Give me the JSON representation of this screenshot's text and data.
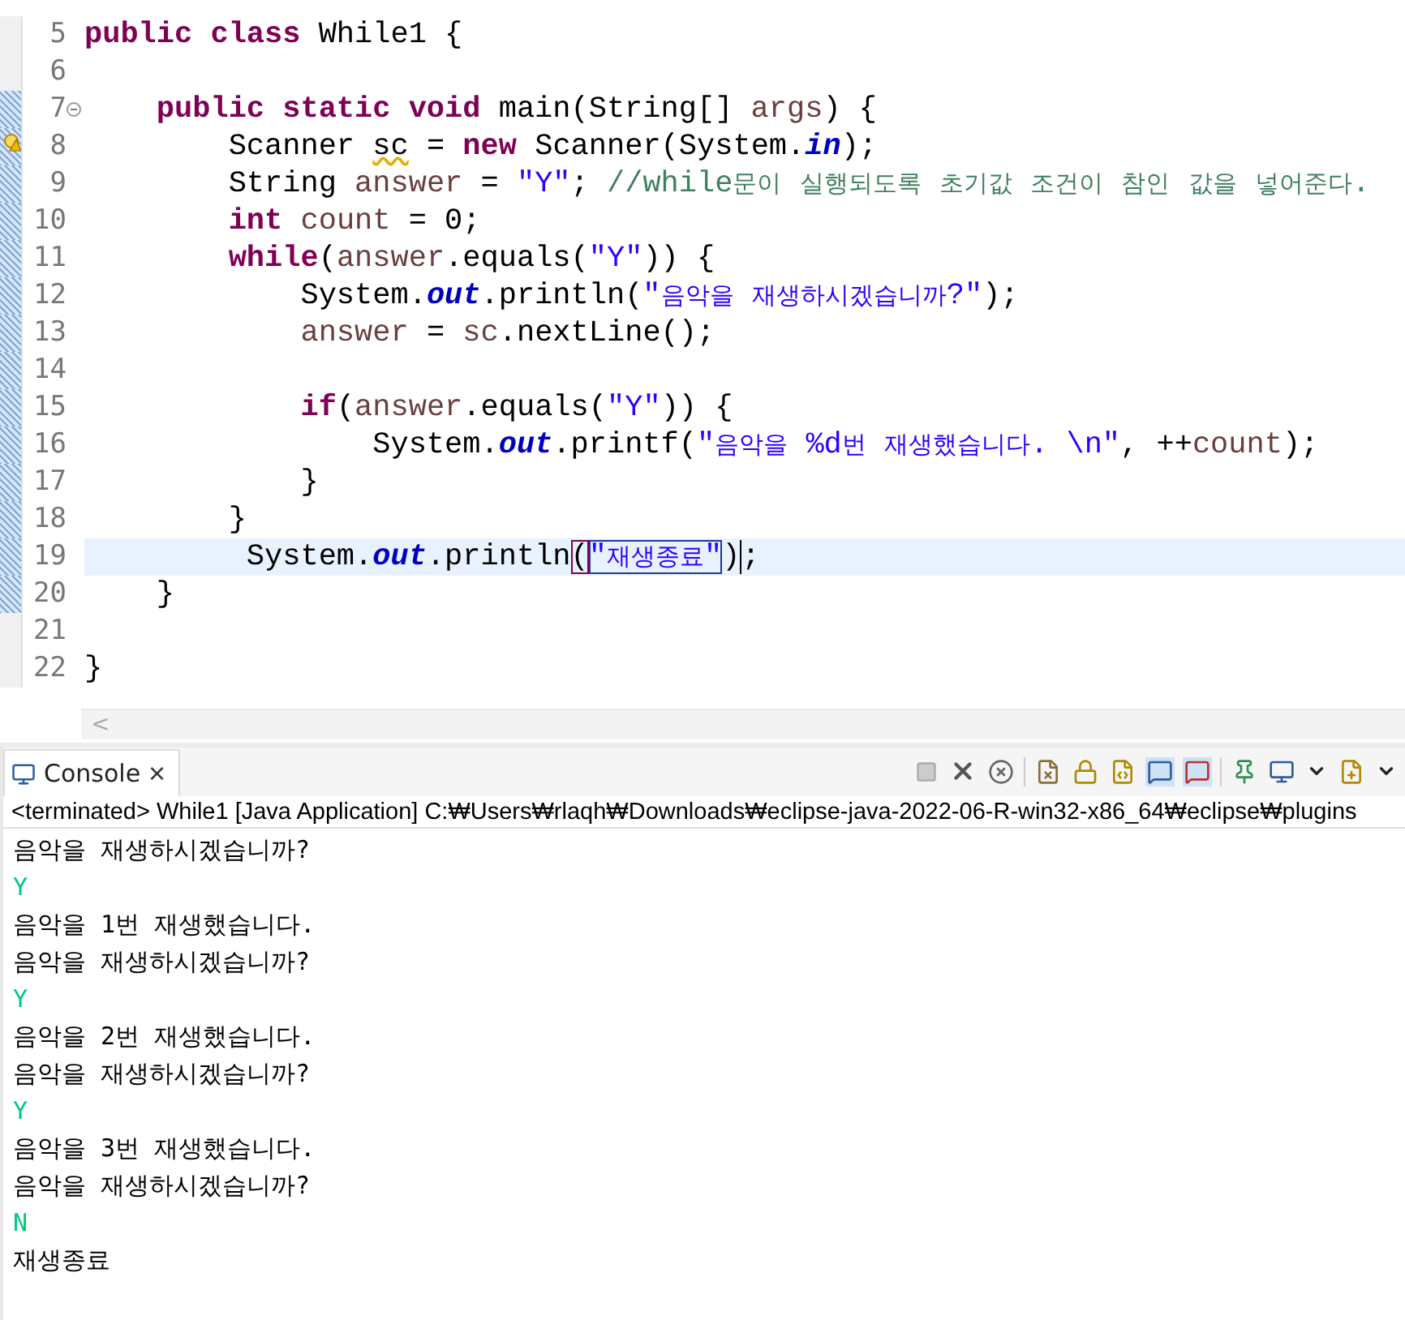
{
  "editor": {
    "lines": [
      {
        "number": "5",
        "current": false,
        "fold": false,
        "warning": false,
        "tokens": [
          {
            "text": "public class ",
            "kind": "keyword"
          },
          {
            "text": "While1 {",
            "kind": "plain"
          }
        ]
      },
      {
        "number": "6",
        "current": false,
        "fold": false,
        "warning": false
      },
      {
        "number": "7",
        "current": false,
        "fold": true,
        "warning": false,
        "tokens": [
          {
            "text": "    public static void ",
            "kind": "keyword"
          },
          {
            "text": "main(String[] ",
            "kind": "plain"
          },
          {
            "text": "args",
            "kind": "var"
          },
          {
            "text": ") {",
            "kind": "plain"
          }
        ]
      },
      {
        "number": "8",
        "current": false,
        "fold": false,
        "warning": true,
        "tokens": [
          {
            "text": "        Scanner ",
            "kind": "plain"
          },
          {
            "text": "sc",
            "kind": "squiggle"
          },
          {
            "text": " = ",
            "kind": "plain"
          },
          {
            "text": "new ",
            "kind": "keyword"
          },
          {
            "text": "Scanner(System.",
            "kind": "plain"
          },
          {
            "text": "in",
            "kind": "field"
          },
          {
            "text": ");",
            "kind": "plain"
          }
        ]
      },
      {
        "number": "9",
        "current": false,
        "fold": false,
        "warning": false,
        "tokens": [
          {
            "text": "        String ",
            "kind": "plain"
          },
          {
            "text": "answer",
            "kind": "var"
          },
          {
            "text": " = ",
            "kind": "plain"
          },
          {
            "text": "\"Y\"",
            "kind": "string"
          },
          {
            "text": "; ",
            "kind": "plain"
          },
          {
            "text": "//while문이 실행되도록 초기값 조건이 참인 값을 넣어준다.",
            "kind": "comment"
          }
        ]
      },
      {
        "number": "10",
        "current": false,
        "fold": false,
        "warning": false,
        "tokens": [
          {
            "text": "        int ",
            "kind": "keyword"
          },
          {
            "text": "count",
            "kind": "var"
          },
          {
            "text": " = 0;",
            "kind": "plain"
          }
        ]
      },
      {
        "number": "11",
        "current": false,
        "fold": false,
        "warning": false,
        "tokens": [
          {
            "text": "        while",
            "kind": "keyword"
          },
          {
            "text": "(",
            "kind": "plain"
          },
          {
            "text": "answer",
            "kind": "var"
          },
          {
            "text": ".equals(",
            "kind": "plain"
          },
          {
            "text": "\"Y\"",
            "kind": "string"
          },
          {
            "text": ")) {",
            "kind": "plain"
          }
        ]
      },
      {
        "number": "12",
        "current": false,
        "fold": false,
        "warning": false,
        "tokens": [
          {
            "text": "            System.",
            "kind": "plain"
          },
          {
            "text": "out",
            "kind": "field"
          },
          {
            "text": ".println(",
            "kind": "plain"
          },
          {
            "text": "\"음악을 재생하시겠습니까?\"",
            "kind": "string"
          },
          {
            "text": ");",
            "kind": "plain"
          }
        ]
      },
      {
        "number": "13",
        "current": false,
        "fold": false,
        "warning": false,
        "tokens": [
          {
            "text": "            answer",
            "kind": "var"
          },
          {
            "text": " = ",
            "kind": "plain"
          },
          {
            "text": "sc",
            "kind": "var"
          },
          {
            "text": ".nextLine();",
            "kind": "plain"
          }
        ]
      },
      {
        "number": "14",
        "current": false,
        "fold": false,
        "warning": false
      },
      {
        "number": "15",
        "current": false,
        "fold": false,
        "warning": false,
        "tokens": [
          {
            "text": "            if",
            "kind": "keyword"
          },
          {
            "text": "(",
            "kind": "plain"
          },
          {
            "text": "answer",
            "kind": "var"
          },
          {
            "text": ".equals(",
            "kind": "plain"
          },
          {
            "text": "\"Y\"",
            "kind": "string"
          },
          {
            "text": ")) {",
            "kind": "plain"
          }
        ]
      },
      {
        "number": "16",
        "current": false,
        "fold": false,
        "warning": false,
        "tokens": [
          {
            "text": "                System.",
            "kind": "plain"
          },
          {
            "text": "out",
            "kind": "field"
          },
          {
            "text": ".printf(",
            "kind": "plain"
          },
          {
            "text": "\"음악을 %d번 재생했습니다. \\n\"",
            "kind": "string"
          },
          {
            "text": ", ++",
            "kind": "plain"
          },
          {
            "text": "count",
            "kind": "var"
          },
          {
            "text": ");",
            "kind": "plain"
          }
        ]
      },
      {
        "number": "17",
        "current": false,
        "fold": false,
        "warning": false,
        "tokens": [
          {
            "text": "            }",
            "kind": "plain"
          }
        ]
      },
      {
        "number": "18",
        "current": false,
        "fold": false,
        "warning": false,
        "tokens": [
          {
            "text": "        }",
            "kind": "plain"
          }
        ]
      },
      {
        "number": "19",
        "current": true,
        "fold": false,
        "warning": false,
        "tokens": [
          {
            "text": "         System.",
            "kind": "plain"
          },
          {
            "text": "out",
            "kind": "field"
          },
          {
            "text": ".println",
            "kind": "plain"
          },
          {
            "text": "(",
            "kind": "match"
          },
          {
            "text": "\"재생종료\"",
            "kind": "matchstring"
          },
          {
            "text": ")",
            "kind": "caret"
          },
          {
            "text": ";",
            "kind": "plain"
          }
        ]
      },
      {
        "number": "20",
        "current": false,
        "fold": false,
        "warning": false,
        "tokens": [
          {
            "text": "    }",
            "kind": "plain"
          }
        ]
      },
      {
        "number": "21",
        "current": false,
        "fold": false,
        "warning": false
      },
      {
        "number": "22",
        "current": false,
        "fold": false,
        "warning": false,
        "tokens": [
          {
            "text": "}",
            "kind": "plain"
          }
        ]
      }
    ],
    "scroll_arrow": "<"
  },
  "console": {
    "tab": {
      "label": "Console",
      "close": "×"
    },
    "status": "<terminated> While1 [Java Application] C:₩Users₩rlaqh₩Downloads₩eclipse-java-2022-06-R-win32-x86_64₩eclipse₩plugins",
    "output": [
      {
        "text": "음악을 재생하시겠습니까?",
        "kind": "out"
      },
      {
        "text": "Y",
        "kind": "in"
      },
      {
        "text": "음악을 1번 재생했습니다.",
        "kind": "out"
      },
      {
        "text": "음악을 재생하시겠습니까?",
        "kind": "out"
      },
      {
        "text": "Y",
        "kind": "in"
      },
      {
        "text": "음악을 2번 재생했습니다.",
        "kind": "out"
      },
      {
        "text": "음악을 재생하시겠습니까?",
        "kind": "out"
      },
      {
        "text": "Y",
        "kind": "in"
      },
      {
        "text": "음악을 3번 재생했습니다.",
        "kind": "out"
      },
      {
        "text": "음악을 재생하시겠습니까?",
        "kind": "out"
      },
      {
        "text": "N",
        "kind": "in"
      },
      {
        "text": "재생종료",
        "kind": "out"
      }
    ]
  }
}
